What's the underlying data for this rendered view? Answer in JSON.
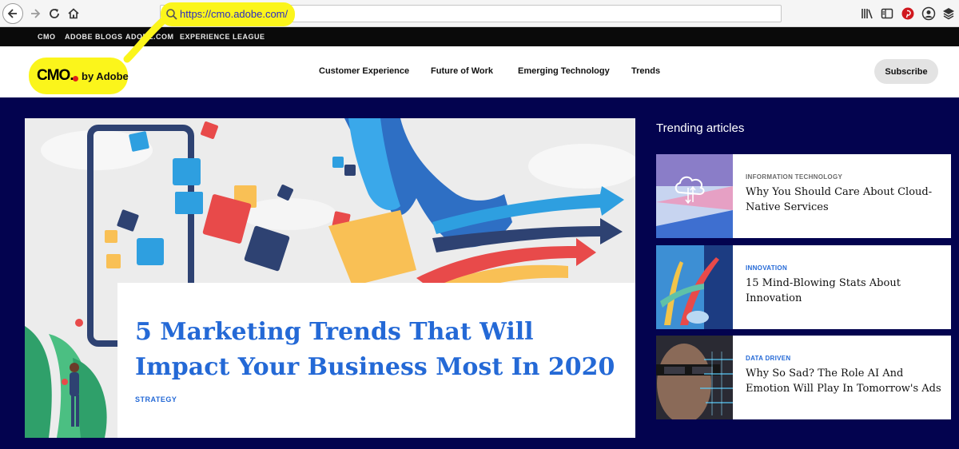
{
  "browser": {
    "url": "https://cmo.adobe.com/",
    "icons": [
      "back-icon",
      "forward-icon",
      "reload-icon",
      "home-icon",
      "search-icon",
      "library-icon",
      "reader-view-icon",
      "pinterest-icon",
      "account-icon",
      "layers-icon"
    ]
  },
  "adobe_strip": {
    "links": [
      "CMO",
      "ADOBE BLOGS",
      "ADOBE.COM",
      "EXPERIENCE LEAGUE"
    ]
  },
  "header": {
    "logo_mark": "CMO.",
    "logo_by": "by Adobe",
    "nav": [
      "Customer Experience",
      "Future of Work",
      "Emerging Technology",
      "Trends"
    ],
    "subscribe_label": "Subscribe"
  },
  "hero": {
    "title": "5 Marketing Trends That Will Impact Your Business Most In 2020",
    "category": "STRATEGY"
  },
  "trending": {
    "heading": "Trending articles",
    "articles": [
      {
        "category": "INFORMATION TECHNOLOGY",
        "title": "Why You Should Care About Cloud-Native Services",
        "category_color": "#6b6b6b"
      },
      {
        "category": "INNOVATION",
        "title": "15 Mind-Blowing Stats About Innovation",
        "category_color": "#2469d6"
      },
      {
        "category": "DATA DRIVEN",
        "title": "Why So Sad? The Role AI And Emotion Will Play In Tomorrow's Ads",
        "category_color": "#2469d6"
      }
    ]
  },
  "colors": {
    "page_bg": "#03034f",
    "accent_blue": "#2469d6",
    "highlight_yellow": "#fbf51b"
  }
}
